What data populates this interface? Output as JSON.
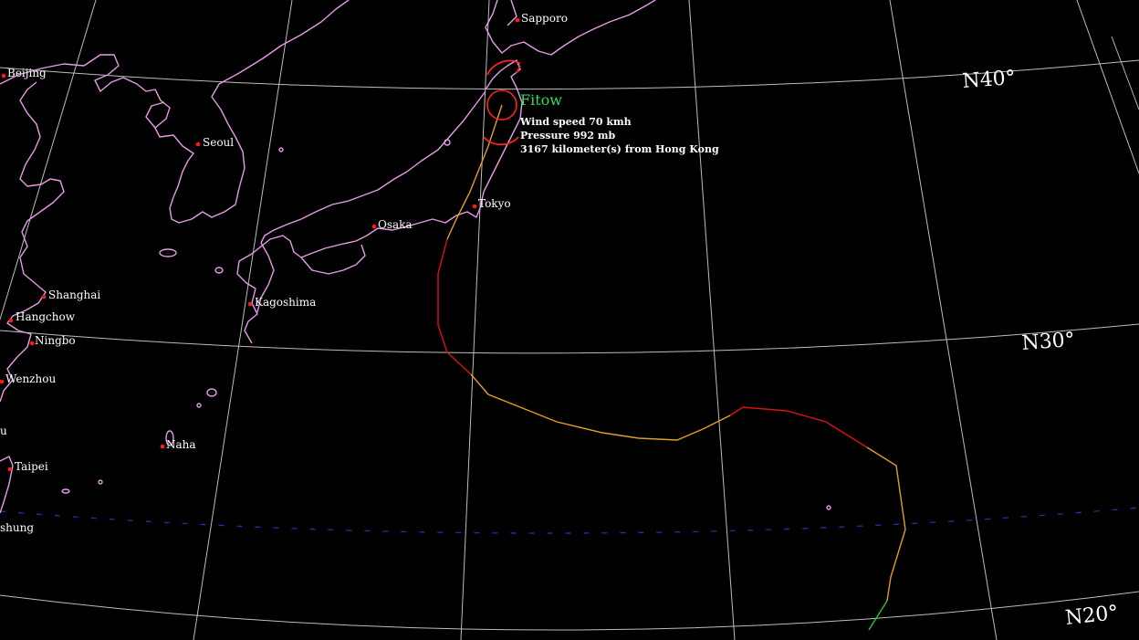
{
  "map": {
    "colors": {
      "background": "#000000",
      "graticule": "#bdbdbd",
      "coastline": "#e59be5",
      "city_marker": "#ff1a1a",
      "tropic_line": "#2233aa",
      "track_red": "#dd1111",
      "track_orange": "#e0a020",
      "track_green": "#22cc22",
      "storm_circle": "#ff2222",
      "storm_name": "#33dd55"
    },
    "latitude_labels": [
      "N40°",
      "N30°",
      "N20°"
    ],
    "cities": [
      {
        "name": "Sapporo"
      },
      {
        "name": "Beijing"
      },
      {
        "name": "Seoul"
      },
      {
        "name": "Tokyo"
      },
      {
        "name": "Osaka"
      },
      {
        "name": "Kagoshima"
      },
      {
        "name": "Shanghai"
      },
      {
        "name": "Hangchow"
      },
      {
        "name": "Ningbo"
      },
      {
        "name": "Wenzhou"
      },
      {
        "name": "u"
      },
      {
        "name": "Naha"
      },
      {
        "name": "Taipei"
      },
      {
        "name": "shung"
      }
    ]
  },
  "storm": {
    "name": "Fitow",
    "wind_speed": "Wind speed 70 kmh",
    "pressure": "Pressure 992 mb",
    "distance": "3167 kilometer(s) from Hong Kong"
  }
}
